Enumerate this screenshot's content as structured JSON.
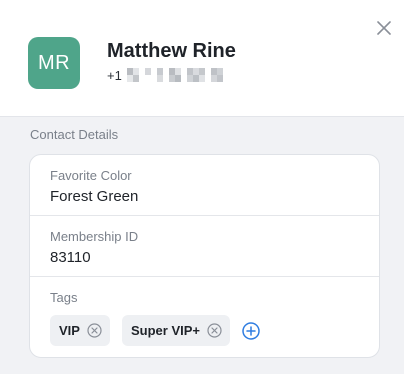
{
  "contact": {
    "initials": "MR",
    "name": "Matthew Rine",
    "phone_prefix": "+1",
    "avatar_color": "#4fa58a"
  },
  "close_icon": "close-icon",
  "details": {
    "section_title": "Contact Details",
    "fields": [
      {
        "label": "Favorite Color",
        "value": "Forest Green"
      },
      {
        "label": "Membership ID",
        "value": "83110"
      }
    ],
    "tags": {
      "label": "Tags",
      "items": [
        "VIP",
        "Super VIP+"
      ],
      "remove_icon": "circle-x-icon",
      "add_icon": "plus-circle-icon",
      "add_color": "#2f7de1"
    }
  }
}
